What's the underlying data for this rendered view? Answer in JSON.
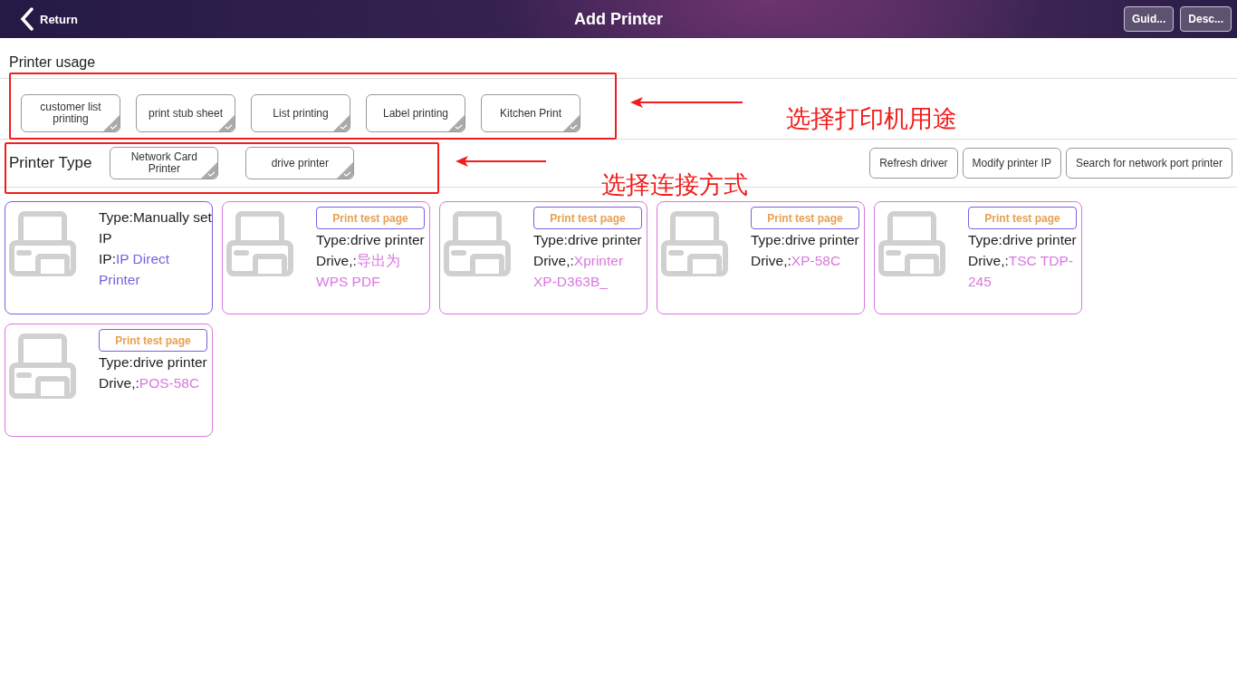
{
  "header": {
    "back": "Return",
    "title": "Add Printer",
    "buttons": [
      "Guid...",
      "Desc..."
    ]
  },
  "usage": {
    "label": "Printer usage",
    "options": [
      {
        "label": "customer list printing",
        "selected": false
      },
      {
        "label": "print stub sheet",
        "selected": false
      },
      {
        "label": "List printing",
        "selected": false
      },
      {
        "label": "Label printing",
        "selected": false
      },
      {
        "label": "Kitchen Print",
        "selected": false
      }
    ]
  },
  "printer_type": {
    "label": "Printer Type",
    "options": [
      {
        "label": "Network Card Printer",
        "selected": false
      },
      {
        "label": "drive printer",
        "selected": false
      }
    ],
    "actions": [
      "Refresh driver",
      "Modify printer IP",
      "Search for network port printer"
    ]
  },
  "printers": [
    {
      "kind": "manual",
      "type": "Type:Manually set IP",
      "value_label": "IP:",
      "value": "IP Direct Printer"
    },
    {
      "kind": "driver",
      "test_button": "Print test page",
      "type": "Type:drive printer",
      "value_label": "Drive,:",
      "value": "导出为 WPS PDF"
    },
    {
      "kind": "driver",
      "test_button": "Print test page",
      "type": "Type:drive printer",
      "value_label": "Drive,:",
      "value": "Xprinter XP-D363B_"
    },
    {
      "kind": "driver",
      "test_button": "Print test page",
      "type": "Type:drive printer",
      "value_label": "Drive,:",
      "value": "XP-58C"
    },
    {
      "kind": "driver",
      "test_button": "Print test page",
      "type": "Type:drive printer",
      "value_label": "Drive,:",
      "value": "TSC TDP-245"
    },
    {
      "kind": "driver",
      "test_button": "Print test page",
      "type": "Type:drive printer",
      "value_label": "Drive,:",
      "value": "POS-58C"
    }
  ],
  "annotations": [
    "选择打印机用途",
    "选择连接方式"
  ]
}
